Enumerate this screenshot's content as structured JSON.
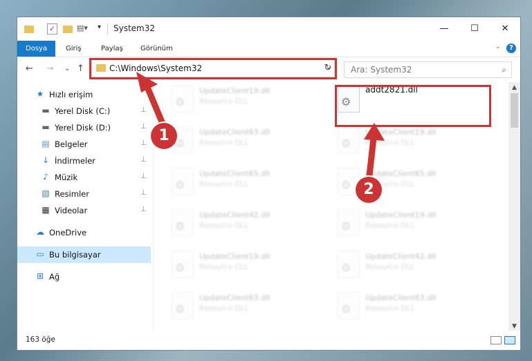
{
  "window": {
    "title": "System32",
    "minimize_glyph": "—",
    "maximize_glyph": "☐",
    "close_glyph": "✕"
  },
  "ribbon": {
    "tabs": [
      "Dosya",
      "Giriş",
      "Paylaş",
      "Görünüm"
    ],
    "help_glyph": "?",
    "expand_glyph": "⌄"
  },
  "nav": {
    "back": "←",
    "forward": "→",
    "recent": "⌄",
    "up": "↑"
  },
  "address": {
    "path": "C:\\Windows\\System32",
    "dropdown_glyph": "⌄",
    "refresh_glyph": "↻"
  },
  "search": {
    "placeholder": "Ara: System32",
    "icon": "⌕"
  },
  "sidebar": {
    "items": [
      {
        "label": "Hızlı erişim",
        "icon": "★"
      },
      {
        "label": "Yerel Disk (C:)",
        "icon": "▬"
      },
      {
        "label": "Yerel Disk (D:)",
        "icon": "▬"
      },
      {
        "label": "Belgeler",
        "icon": "▤"
      },
      {
        "label": "İndirmeler",
        "icon": "↓"
      },
      {
        "label": "Müzik",
        "icon": "♪"
      },
      {
        "label": "Resimler",
        "icon": "▧"
      },
      {
        "label": "Videolar",
        "icon": "▦"
      },
      {
        "label": "OneDrive",
        "icon": "☁"
      },
      {
        "label": "Bu bilgisayar",
        "icon": "▭"
      },
      {
        "label": "Ağ",
        "icon": "⊞"
      }
    ],
    "pin_glyph": "⊥"
  },
  "files": {
    "left": [
      {
        "name": "UpdateClient19.dll",
        "type": "Resource DLL"
      },
      {
        "name": "UpdateClient63.dll",
        "type": "Resource DLL"
      },
      {
        "name": "UpdateClient65.dll",
        "type": "Resource DLL"
      },
      {
        "name": "UpdateClient42.dll",
        "type": "Resource DLL"
      },
      {
        "name": "UpdateClient19.dll",
        "type": "Resource DLL"
      },
      {
        "name": "UpdateClient63.dll",
        "type": "Resource DLL"
      }
    ],
    "highlighted": {
      "name": "addt2821.dll"
    },
    "right": [
      {
        "name": "UpdateClient19.dll",
        "type": "Resource DLL"
      },
      {
        "name": "UpdateClient65.dll",
        "type": "Resource DLL"
      },
      {
        "name": "UpdateClient19.dll",
        "type": "Resource DLL"
      },
      {
        "name": "UpdateClient42.dll",
        "type": "Resource DLL"
      },
      {
        "name": "UpdateClient63.dll",
        "type": "Resource DLL"
      }
    ]
  },
  "scrollbar": {
    "up": "▲",
    "down": "▼"
  },
  "status": {
    "count": "163 öğe"
  },
  "callouts": [
    "1",
    "2"
  ],
  "colors": {
    "accent": "#1979ca",
    "highlight_red": "#cc3333",
    "selection": "#cce8ff"
  }
}
